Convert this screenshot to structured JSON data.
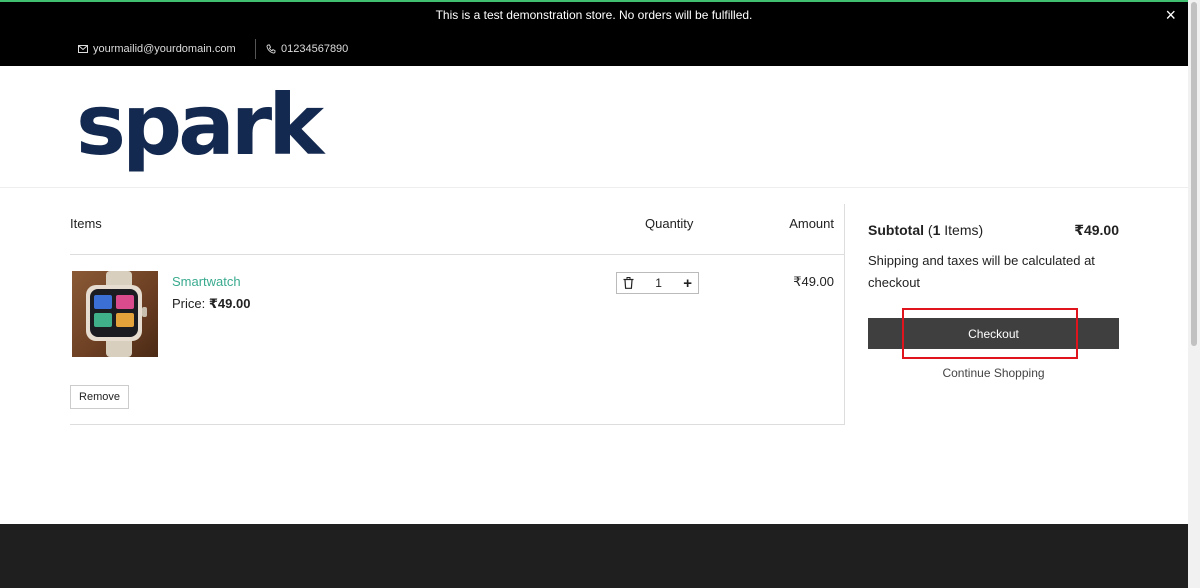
{
  "announcement": {
    "text": "This is a test demonstration store. No orders will be fulfilled.",
    "close_label": "×"
  },
  "contact": {
    "email": "yourmailid@yourdomain.com",
    "phone": "01234567890"
  },
  "brand": {
    "name": "spark",
    "color": "#14294f"
  },
  "cart": {
    "headers": {
      "items": "Items",
      "quantity": "Quantity",
      "amount": "Amount"
    },
    "items": [
      {
        "name": "Smartwatch",
        "price_label": "Price:",
        "price": "₹49.00",
        "quantity": "1",
        "amount": "₹49.00"
      }
    ],
    "remove_label": "Remove"
  },
  "summary": {
    "subtotal_label": "Subtotal",
    "open_paren": "(",
    "item_count": "1",
    "items_word": "Items)",
    "subtotal_value": "₹49.00",
    "shipping_note": "Shipping and taxes will be calculated at checkout",
    "checkout_label": "Checkout",
    "continue_label": "Continue Shopping"
  },
  "colors": {
    "accent_green": "#3aaa8f",
    "checkout_bg": "#3f3f3f",
    "highlight": "#e0141c"
  }
}
